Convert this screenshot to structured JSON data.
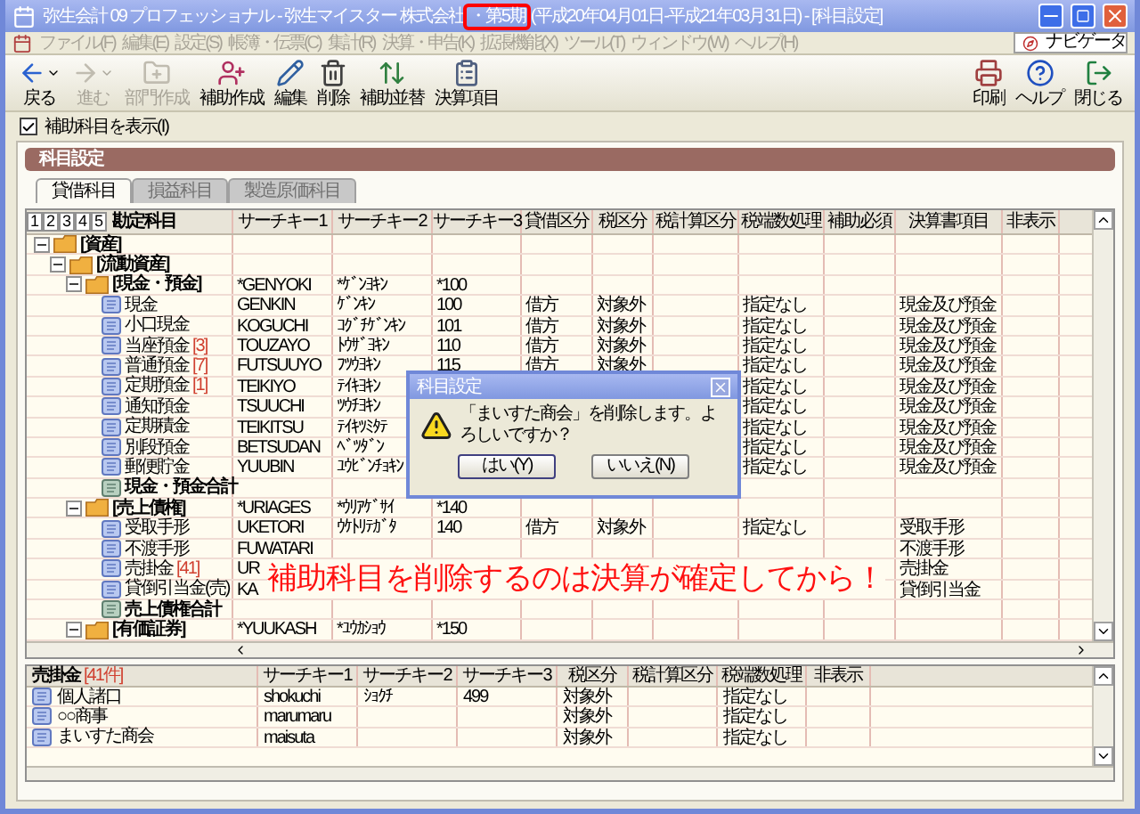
{
  "window": {
    "title": [
      {
        "text": "弥生会計 09 プロフェッショナル - 弥生マイスター 株式会社",
        "highlighted": false
      },
      {
        "text": "・第5期",
        "highlighted": true
      },
      {
        "text": "(平成20年04月01日-平成21年03月31日) - [科目設定]",
        "highlighted": false
      }
    ]
  },
  "menu": [
    {
      "label": "ファイル(F)",
      "disabled": true
    },
    {
      "label": "編集(E)",
      "disabled": true
    },
    {
      "label": "設定(S)",
      "disabled": true
    },
    {
      "label": "帳簿・伝票(C)",
      "disabled": true
    },
    {
      "label": "集計(R)",
      "disabled": true
    },
    {
      "label": "決算・申告(K)",
      "disabled": true
    },
    {
      "label": "拡張機能(X)",
      "disabled": true
    },
    {
      "label": "ツール(T)",
      "disabled": true
    },
    {
      "label": "ウィンドウ(W)",
      "disabled": true
    },
    {
      "label": "ヘルプ(H)",
      "disabled": true
    }
  ],
  "navigator": "ナビゲータ",
  "toolbar": [
    {
      "label": "戻る",
      "disabled": false,
      "dropdown": true
    },
    {
      "label": "進む",
      "disabled": true,
      "dropdown": true
    },
    {
      "label": "部門作成",
      "disabled": true,
      "dropdown": false
    },
    {
      "label": "補助作成",
      "disabled": false,
      "dropdown": false
    },
    {
      "label": "編集",
      "disabled": false,
      "dropdown": false
    },
    {
      "label": "削除",
      "disabled": false,
      "dropdown": false
    },
    {
      "label": "補助並替",
      "disabled": false,
      "dropdown": false
    },
    {
      "label": "決算項目",
      "disabled": false,
      "dropdown": false
    }
  ],
  "toolbar_right": [
    "印刷",
    "ヘルプ",
    "閉じる"
  ],
  "show_sub_accounts": {
    "label": "補助科目を表示(I)",
    "checked": true
  },
  "panel_title": "科目設定",
  "tabs": [
    {
      "label": "貸借科目",
      "selected": true
    },
    {
      "label": "損益科目",
      "selected": false
    },
    {
      "label": "製造原価科目",
      "selected": false
    }
  ],
  "levels": [
    "1",
    "2",
    "3",
    "4",
    "5"
  ],
  "columns": [
    "勘定科目",
    "サーチキー1",
    "サーチキー2",
    "サーチキー3",
    "貸借区分",
    "税区分",
    "税計算区分",
    "税端数処理",
    "補助必須",
    "決算書項目",
    "非表示"
  ],
  "tree": [
    {
      "name": "[資産]",
      "kind": "group",
      "expanded": true,
      "children": [
        {
          "name": "[流動資産]",
          "kind": "group",
          "expanded": true,
          "children": [
            {
              "name": "[現金・預金]",
              "kind": "group",
              "expanded": true,
              "cells": [
                "*GENYOKI",
                "*ｹﾞﾝﾖｷﾝ",
                "*100"
              ],
              "children": [
                {
                  "name": "現金",
                  "kind": "item",
                  "cells": [
                    "GENKIN",
                    "ｹﾞﾝｷﾝ",
                    "100",
                    "借方",
                    "対象外",
                    null,
                    "指定なし",
                    null,
                    "現金及び預金"
                  ]
                },
                {
                  "name": "小口現金",
                  "kind": "item",
                  "cells": [
                    "KOGUCHI",
                    "ｺｸﾞﾁｹﾞﾝｷﾝ",
                    "101",
                    "借方",
                    "対象外",
                    null,
                    "指定なし",
                    null,
                    "現金及び預金"
                  ]
                },
                {
                  "name": "当座預金",
                  "count": "[3]",
                  "kind": "item",
                  "cells": [
                    "TOUZAYO",
                    "ﾄｳｻﾞﾖｷﾝ",
                    "110",
                    "借方",
                    "対象外",
                    null,
                    "指定なし",
                    null,
                    "現金及び預金"
                  ]
                },
                {
                  "name": "普通預金",
                  "count": "[7]",
                  "kind": "item",
                  "cells": [
                    "FUTSUUYO",
                    "ﾌﾂｳﾖｷﾝ",
                    "115",
                    "借方",
                    "対象外",
                    null,
                    "指定なし",
                    null,
                    "現金及び預金"
                  ]
                },
                {
                  "name": "定期預金",
                  "count": "[1]",
                  "kind": "item",
                  "cells": [
                    "TEIKIYO",
                    "ﾃｲｷﾖｷﾝ",
                    null,
                    null,
                    null,
                    null,
                    "指定なし",
                    null,
                    "現金及び預金"
                  ]
                },
                {
                  "name": "通知預金",
                  "kind": "item",
                  "cells": [
                    "TSUUCHI",
                    "ﾂｳﾁﾖｷﾝ",
                    null,
                    null,
                    null,
                    null,
                    "指定なし",
                    null,
                    "現金及び預金"
                  ]
                },
                {
                  "name": "定期積金",
                  "kind": "item",
                  "cells": [
                    "TEIKITSU",
                    "ﾃｲｷﾂﾐﾀﾃ",
                    null,
                    null,
                    null,
                    null,
                    "指定なし",
                    null,
                    "現金及び預金"
                  ]
                },
                {
                  "name": "別段預金",
                  "kind": "item",
                  "cells": [
                    "BETSUDAN",
                    "ﾍﾞﾂﾀﾞﾝ",
                    null,
                    null,
                    null,
                    null,
                    "指定なし",
                    null,
                    "現金及び預金"
                  ]
                },
                {
                  "name": "郵便貯金",
                  "kind": "item",
                  "cells": [
                    "YUUBIN",
                    "ﾕｳﾋﾞﾝﾁｮｷﾝ",
                    null,
                    null,
                    null,
                    null,
                    "指定なし",
                    null,
                    "現金及び預金"
                  ]
                },
                {
                  "name": "現金・預金合計",
                  "kind": "total"
                }
              ]
            },
            {
              "name": "[売上債権]",
              "kind": "group",
              "expanded": true,
              "cells": [
                "*URIAGES",
                "*ｳﾘｱｹﾞｻｲ",
                "*140"
              ],
              "children": [
                {
                  "name": "受取手形",
                  "kind": "item",
                  "cells": [
                    "UKETORI",
                    "ｳｹﾄﾘﾃｶﾞﾀ",
                    "140",
                    "借方",
                    "対象外",
                    null,
                    "指定なし",
                    null,
                    "受取手形"
                  ]
                },
                {
                  "name": "不渡手形",
                  "kind": "item",
                  "cells": [
                    "FUWATARI",
                    null,
                    null,
                    null,
                    null,
                    null,
                    null,
                    null,
                    "不渡手形"
                  ]
                },
                {
                  "name": "売掛金",
                  "count": "[41]",
                  "kind": "item",
                  "cells": [
                    "UR",
                    null,
                    null,
                    null,
                    null,
                    null,
                    null,
                    null,
                    "売掛金"
                  ]
                },
                {
                  "name": "貸倒引当金(売)",
                  "kind": "item",
                  "cells": [
                    "KA",
                    null,
                    null,
                    null,
                    null,
                    null,
                    null,
                    null,
                    "貸倒引当金"
                  ]
                },
                {
                  "name": "売上債権合計",
                  "kind": "total"
                }
              ]
            },
            {
              "name": "[有価証券]",
              "kind": "group",
              "expanded": true,
              "cells": [
                "*YUUKASH",
                "*ﾕｳｶｼｮｳ",
                "*150"
              ]
            }
          ]
        }
      ]
    }
  ],
  "sub_table": {
    "account": "売掛金",
    "count": "[41件]",
    "columns": [
      "サーチキー1",
      "サーチキー2",
      "サーチキー3",
      "税区分",
      "税計算区分",
      "税端数処理",
      "非表示"
    ],
    "rows": [
      {
        "name": "個人諸口",
        "cells": [
          "shokuchi",
          "ｼｮｸﾁ",
          "499",
          "対象外",
          null,
          "指定なし"
        ]
      },
      {
        "name": "○○商事",
        "cells": [
          "marumaru",
          null,
          null,
          "対象外",
          null,
          "指定なし"
        ]
      },
      {
        "name": "まいすた商会",
        "cells": [
          "maisuta",
          null,
          null,
          "対象外",
          null,
          "指定なし"
        ]
      }
    ]
  },
  "dialog": {
    "title": "科目設定",
    "message": "「まいすた商会」を削除します。よろしいですか？",
    "buttons": [
      "はい(Y)",
      "いいえ(N)"
    ]
  },
  "annotation": "補助科目を削除するのは決算が確定してから！"
}
